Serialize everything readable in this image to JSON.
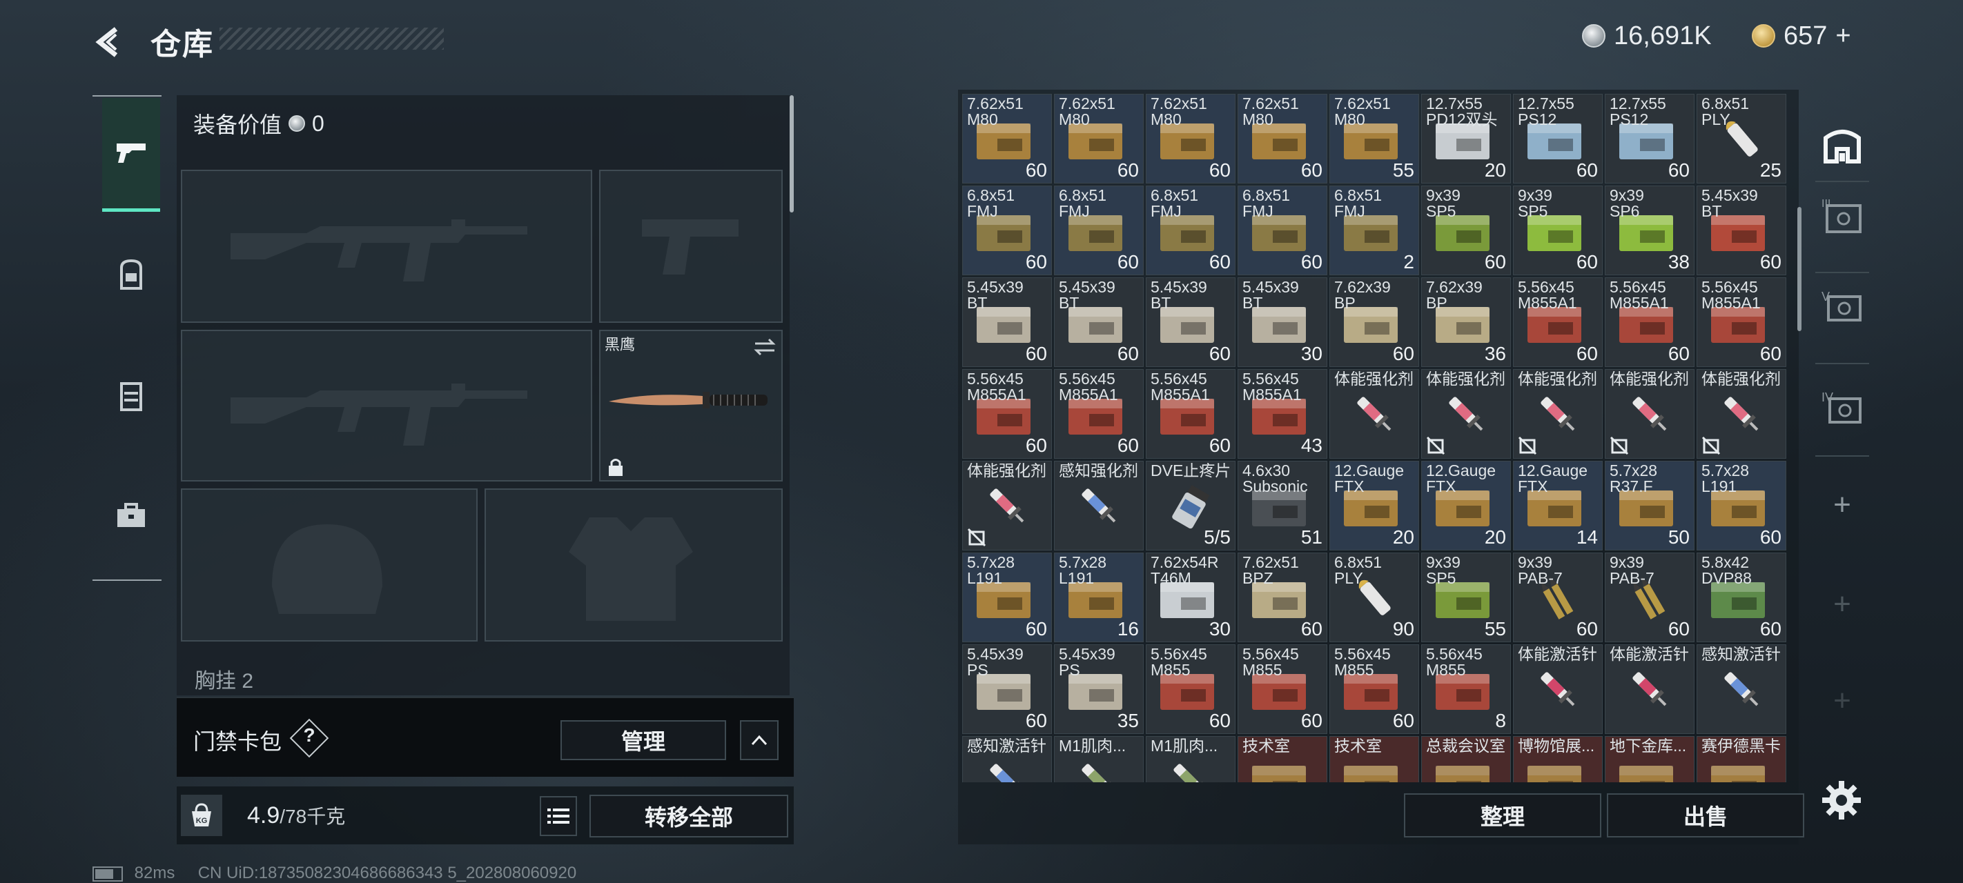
{
  "header": {
    "title": "仓库",
    "silver": "16,691K",
    "gold": "657",
    "gold_plus": "+"
  },
  "equipment": {
    "value_label": "装备价值",
    "value": "0",
    "knife_name": "黑鹰",
    "chest_label": "胸挂",
    "chest_count": "2",
    "keycard_label": "门禁卡包",
    "help": "?",
    "manage_label": "管理",
    "weight": "4.9",
    "weight_max": "/78千克",
    "transfer_all_label": "转移全部"
  },
  "stash": {
    "sort_label": "整理",
    "sell_label": "出售",
    "items": [
      {
        "name": "7.62x51\nM80",
        "qty": "60",
        "kind": "box",
        "color": "#a8813d",
        "bg": "blue"
      },
      {
        "name": "7.62x51\nM80",
        "qty": "60",
        "kind": "box",
        "color": "#a8813d",
        "bg": "blue"
      },
      {
        "name": "7.62x51\nM80",
        "qty": "60",
        "kind": "box",
        "color": "#a8813d",
        "bg": "blue"
      },
      {
        "name": "7.62x51\nM80",
        "qty": "60",
        "kind": "box",
        "color": "#a8813d",
        "bg": "blue"
      },
      {
        "name": "7.62x51\nM80",
        "qty": "55",
        "kind": "box",
        "color": "#a8813d",
        "bg": "blue"
      },
      {
        "name": "12.7x55\nPD12双头",
        "qty": "20",
        "kind": "box",
        "color": "#c7ccd0",
        "bg": "grey"
      },
      {
        "name": "12.7x55\nPS12",
        "qty": "60",
        "kind": "box",
        "color": "#8fb0c9",
        "bg": "grey"
      },
      {
        "name": "12.7x55\nPS12",
        "qty": "60",
        "kind": "box",
        "color": "#8fb0c9",
        "bg": "grey"
      },
      {
        "name": "6.8x51\nPLY",
        "qty": "25",
        "kind": "round",
        "color": "#e6e6e6",
        "bg": "grey"
      },
      {
        "name": "6.8x51\nFMJ",
        "qty": "60",
        "kind": "box",
        "color": "#8a7a45",
        "bg": "blue"
      },
      {
        "name": "6.8x51\nFMJ",
        "qty": "60",
        "kind": "box",
        "color": "#8a7a45",
        "bg": "blue"
      },
      {
        "name": "6.8x51\nFMJ",
        "qty": "60",
        "kind": "box",
        "color": "#8a7a45",
        "bg": "blue"
      },
      {
        "name": "6.8x51\nFMJ",
        "qty": "60",
        "kind": "box",
        "color": "#8a7a45",
        "bg": "blue"
      },
      {
        "name": "6.8x51\nFMJ",
        "qty": "2",
        "kind": "box",
        "color": "#8a7a45",
        "bg": "blue"
      },
      {
        "name": "9x39\nSP5",
        "qty": "60",
        "kind": "box",
        "color": "#7a9a3a",
        "bg": "grey"
      },
      {
        "name": "9x39\nSP5",
        "qty": "60",
        "kind": "box",
        "color": "#8dbb3e",
        "bg": "grey"
      },
      {
        "name": "9x39\nSP6",
        "qty": "38",
        "kind": "box",
        "color": "#8dbb3e",
        "bg": "grey"
      },
      {
        "name": "5.45x39\nBT",
        "qty": "60",
        "kind": "box",
        "color": "#b24a3a",
        "bg": "grey"
      },
      {
        "name": "5.45x39\nBT",
        "qty": "60",
        "kind": "box",
        "color": "#b7b0a0",
        "bg": "grey"
      },
      {
        "name": "5.45x39\nBT",
        "qty": "60",
        "kind": "box",
        "color": "#b7b0a0",
        "bg": "grey"
      },
      {
        "name": "5.45x39\nBT",
        "qty": "60",
        "kind": "box",
        "color": "#b7b0a0",
        "bg": "grey"
      },
      {
        "name": "5.45x39\nBT",
        "qty": "30",
        "kind": "box",
        "color": "#b7b0a0",
        "bg": "grey"
      },
      {
        "name": "7.62x39\nBP",
        "qty": "60",
        "kind": "box",
        "color": "#b8ab86",
        "bg": "grey"
      },
      {
        "name": "7.62x39\nBP",
        "qty": "36",
        "kind": "box",
        "color": "#b8ab86",
        "bg": "grey"
      },
      {
        "name": "5.56x45\nM855A1",
        "qty": "60",
        "kind": "box",
        "color": "#a8473a",
        "bg": "grey"
      },
      {
        "name": "5.56x45\nM855A1",
        "qty": "60",
        "kind": "box",
        "color": "#a8473a",
        "bg": "grey"
      },
      {
        "name": "5.56x45\nM855A1",
        "qty": "60",
        "kind": "box",
        "color": "#a8473a",
        "bg": "grey"
      },
      {
        "name": "5.56x45\nM855A1",
        "qty": "60",
        "kind": "box",
        "color": "#a8473a",
        "bg": "grey"
      },
      {
        "name": "5.56x45\nM855A1",
        "qty": "60",
        "kind": "box",
        "color": "#a8473a",
        "bg": "grey"
      },
      {
        "name": "5.56x45\nM855A1",
        "qty": "60",
        "kind": "box",
        "color": "#a8473a",
        "bg": "grey"
      },
      {
        "name": "5.56x45\nM855A1",
        "qty": "43",
        "kind": "box",
        "color": "#a8473a",
        "bg": "grey"
      },
      {
        "name": "体能强化剂",
        "qty": "",
        "kind": "syringe",
        "color": "#e06b82",
        "bg": "grey"
      },
      {
        "name": "体能强化剂",
        "qty": "",
        "kind": "syringe",
        "color": "#e06b82",
        "bg": "grey",
        "nolock": true
      },
      {
        "name": "体能强化剂",
        "qty": "",
        "kind": "syringe",
        "color": "#e06b82",
        "bg": "grey",
        "nolock": true
      },
      {
        "name": "体能强化剂",
        "qty": "",
        "kind": "syringe",
        "color": "#e06b82",
        "bg": "grey",
        "nolock": true
      },
      {
        "name": "体能强化剂",
        "qty": "",
        "kind": "syringe",
        "color": "#e06b82",
        "bg": "grey",
        "nolock": true
      },
      {
        "name": "体能强化剂",
        "qty": "",
        "kind": "syringe",
        "color": "#e06b82",
        "bg": "grey",
        "nolock": true
      },
      {
        "name": "感知强化剂",
        "qty": "",
        "kind": "syringe",
        "color": "#6a92d8",
        "bg": "grey"
      },
      {
        "name": "DVE止疼片",
        "qty": "5/5",
        "kind": "pill",
        "color": "#c9ced2",
        "bg": "grey"
      },
      {
        "name": "4.6x30\nSubsonic",
        "qty": "51",
        "kind": "box",
        "color": "#4a4f54",
        "bg": "grey"
      },
      {
        "name": "12.Gauge\nFTX",
        "qty": "20",
        "kind": "box",
        "color": "#a8813d",
        "bg": "blue"
      },
      {
        "name": "12.Gauge\nFTX",
        "qty": "20",
        "kind": "box",
        "color": "#a8813d",
        "bg": "blue"
      },
      {
        "name": "12.Gauge\nFTX",
        "qty": "14",
        "kind": "box",
        "color": "#a8813d",
        "bg": "blue"
      },
      {
        "name": "5.7x28\nR37.F",
        "qty": "50",
        "kind": "box",
        "color": "#a8813d",
        "bg": "blue"
      },
      {
        "name": "5.7x28\nL191",
        "qty": "60",
        "kind": "box",
        "color": "#a8813d",
        "bg": "blue"
      },
      {
        "name": "5.7x28\nL191",
        "qty": "60",
        "kind": "box",
        "color": "#a8813d",
        "bg": "blue"
      },
      {
        "name": "5.7x28\nL191",
        "qty": "16",
        "kind": "box",
        "color": "#a8813d",
        "bg": "blue"
      },
      {
        "name": "7.62x54R\nT46M",
        "qty": "30",
        "kind": "box",
        "color": "#c9ced2",
        "bg": "grey"
      },
      {
        "name": "7.62x51\nBPZ",
        "qty": "60",
        "kind": "box",
        "color": "#b8ab86",
        "bg": "grey"
      },
      {
        "name": "6.8x51\nPLY",
        "qty": "90",
        "kind": "round",
        "color": "#e6e6e6",
        "bg": "grey"
      },
      {
        "name": "9x39\nSP5",
        "qty": "55",
        "kind": "box",
        "color": "#7a9a3a",
        "bg": "grey"
      },
      {
        "name": "9x39\nPAB-7",
        "qty": "60",
        "kind": "bullets",
        "color": "#b89a45",
        "bg": "grey"
      },
      {
        "name": "9x39\nPAB-7",
        "qty": "60",
        "kind": "bullets",
        "color": "#b89a45",
        "bg": "grey"
      },
      {
        "name": "5.8x42\nDVP88",
        "qty": "60",
        "kind": "box",
        "color": "#5d8a4a",
        "bg": "grey"
      },
      {
        "name": "5.45x39\nPS",
        "qty": "60",
        "kind": "box",
        "color": "#b7b0a0",
        "bg": "grey"
      },
      {
        "name": "5.45x39\nPS",
        "qty": "35",
        "kind": "box",
        "color": "#b7b0a0",
        "bg": "grey"
      },
      {
        "name": "5.56x45\nM855",
        "qty": "60",
        "kind": "box",
        "color": "#a8473a",
        "bg": "grey"
      },
      {
        "name": "5.56x45\nM855",
        "qty": "60",
        "kind": "box",
        "color": "#a8473a",
        "bg": "grey"
      },
      {
        "name": "5.56x45\nM855",
        "qty": "60",
        "kind": "box",
        "color": "#a8473a",
        "bg": "grey"
      },
      {
        "name": "5.56x45\nM855",
        "qty": "8",
        "kind": "box",
        "color": "#a8473a",
        "bg": "grey"
      },
      {
        "name": "体能激活针",
        "qty": "",
        "kind": "syringe",
        "color": "#d2466a",
        "bg": "grey"
      },
      {
        "name": "体能激活针",
        "qty": "",
        "kind": "syringe",
        "color": "#d2466a",
        "bg": "grey"
      },
      {
        "name": "感知激活针",
        "qty": "",
        "kind": "syringe",
        "color": "#6a92d8",
        "bg": "grey"
      },
      {
        "name": "感知激活针",
        "qty": "",
        "kind": "syringe",
        "color": "#6a92d8",
        "bg": "grey"
      },
      {
        "name": "M1肌肉...",
        "qty": "",
        "kind": "syringe",
        "color": "#8da46a",
        "bg": "grey"
      },
      {
        "name": "M1肌肉...",
        "qty": "",
        "kind": "syringe",
        "color": "#8da46a",
        "bg": "grey"
      },
      {
        "name": "技术室",
        "qty": "",
        "kind": "card",
        "color": "#c9a24a",
        "bg": "red"
      },
      {
        "name": "技术室",
        "qty": "",
        "kind": "card",
        "color": "#c9a24a",
        "bg": "red"
      },
      {
        "name": "总裁会议室",
        "qty": "",
        "kind": "card",
        "color": "#c9a24a",
        "bg": "red"
      },
      {
        "name": "博物馆展...",
        "qty": "",
        "kind": "card",
        "color": "#c9a24a",
        "bg": "red"
      },
      {
        "name": "地下金库...",
        "qty": "",
        "kind": "card",
        "color": "#c9a24a",
        "bg": "red"
      },
      {
        "name": "赛伊德黑卡",
        "qty": "",
        "kind": "card",
        "color": "#c9a24a",
        "bg": "red"
      }
    ]
  },
  "right_rail": {
    "items": [
      "III",
      "V",
      "IV"
    ],
    "add": "+"
  },
  "status": {
    "ping": "82ms",
    "uid": "CN UiD:18735082304686686343 5_202808060920"
  },
  "colors": {
    "accent": "#5ee6c3",
    "panel": "#181f25",
    "stash_bg": "#2d3b4d"
  }
}
